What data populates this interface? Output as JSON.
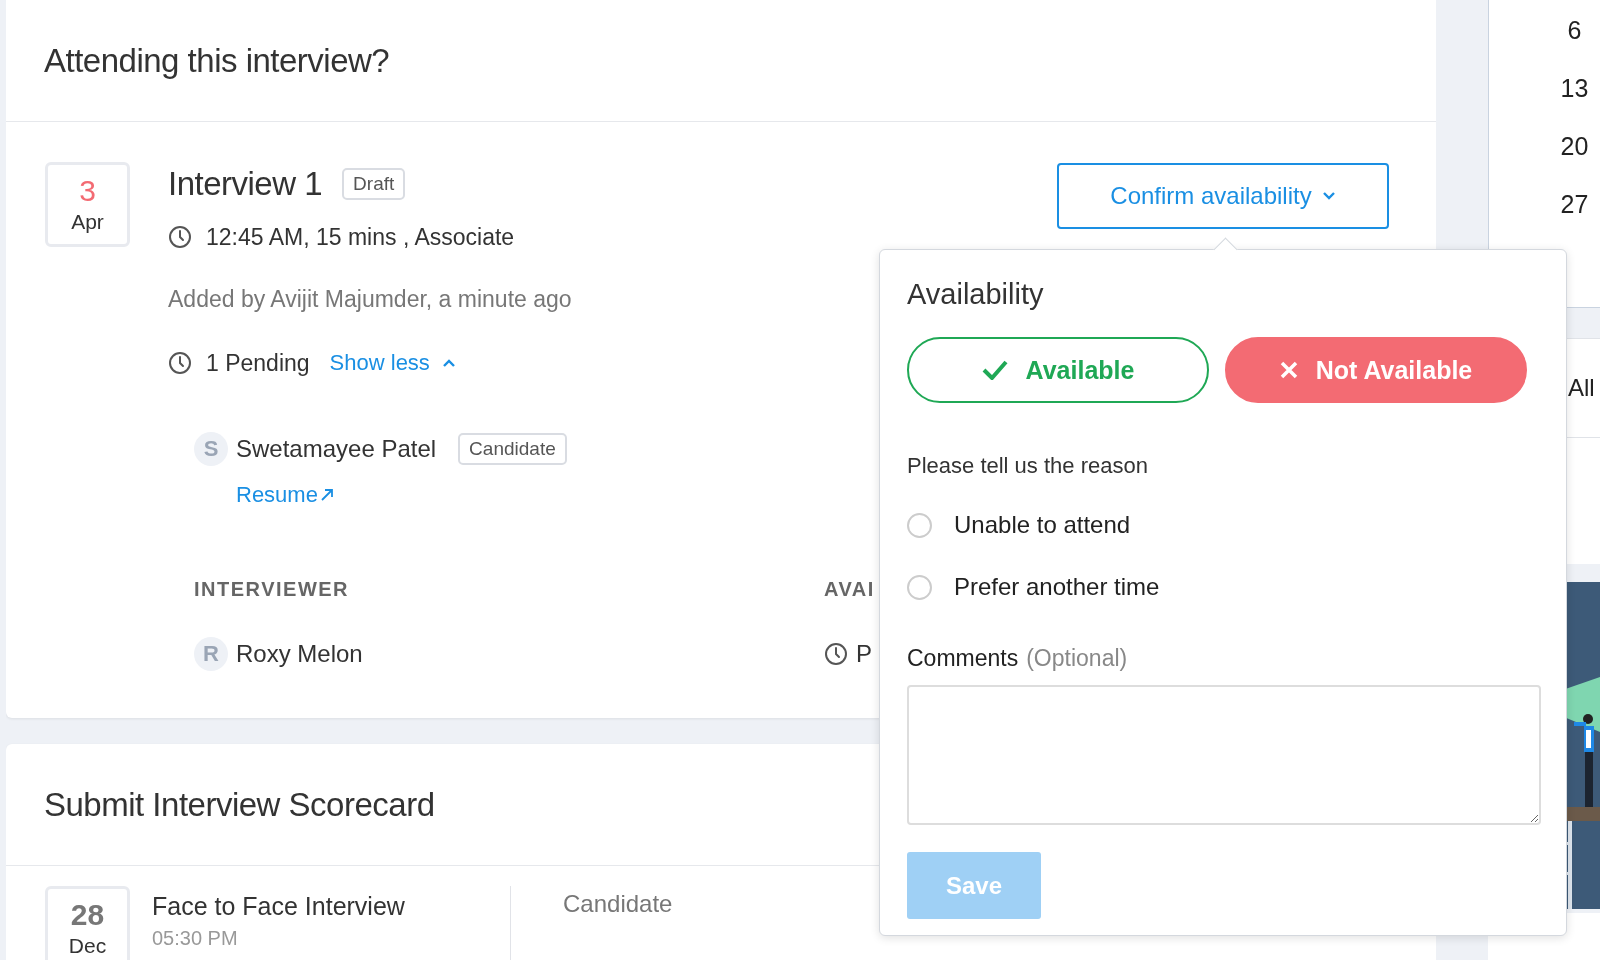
{
  "attending_card": {
    "title": "Attending this interview?",
    "interview": {
      "day": "3",
      "month": "Apr",
      "title": "Interview 1",
      "status": "Draft",
      "schedule": "12:45 AM, 15 mins , Associate",
      "added_by": "Added by Avijit Majumder, a minute ago",
      "pending": "1 Pending",
      "toggle": "Show less",
      "expanded": true,
      "candidate": {
        "initial": "S",
        "name": "Swetamayee Patel",
        "role": "Candidate",
        "link": "Resume"
      },
      "columns": [
        "INTERVIEWER",
        "AVAI"
      ],
      "interviewers": [
        {
          "initial": "R",
          "name": "Roxy Melon",
          "availability": "P"
        }
      ]
    },
    "confirm_button": "Confirm availability"
  },
  "availability_popover": {
    "title": "Availability",
    "options": [
      {
        "label": "Available",
        "kind": "available",
        "selected": false
      },
      {
        "label": "Not Available",
        "kind": "not_available",
        "selected": true
      }
    ],
    "reason_prompt": "Please tell us the reason",
    "reasons": [
      {
        "label": "Unable to attend",
        "selected": false
      },
      {
        "label": "Prefer another time",
        "selected": false
      }
    ],
    "comments_label": "Comments",
    "comments_hint": "(Optional)",
    "save_button": {
      "label": "Save",
      "disabled": true
    }
  },
  "scorecard_card": {
    "title": "Submit Interview Scorecard",
    "interview": {
      "day": "28",
      "month": "Dec",
      "title": "Face to Face Interview",
      "time": "05:30 PM",
      "column": "Candidate"
    }
  },
  "side_panel": {
    "calendar_days": [
      "6",
      "13",
      "20",
      "27"
    ],
    "filter": "All"
  }
}
